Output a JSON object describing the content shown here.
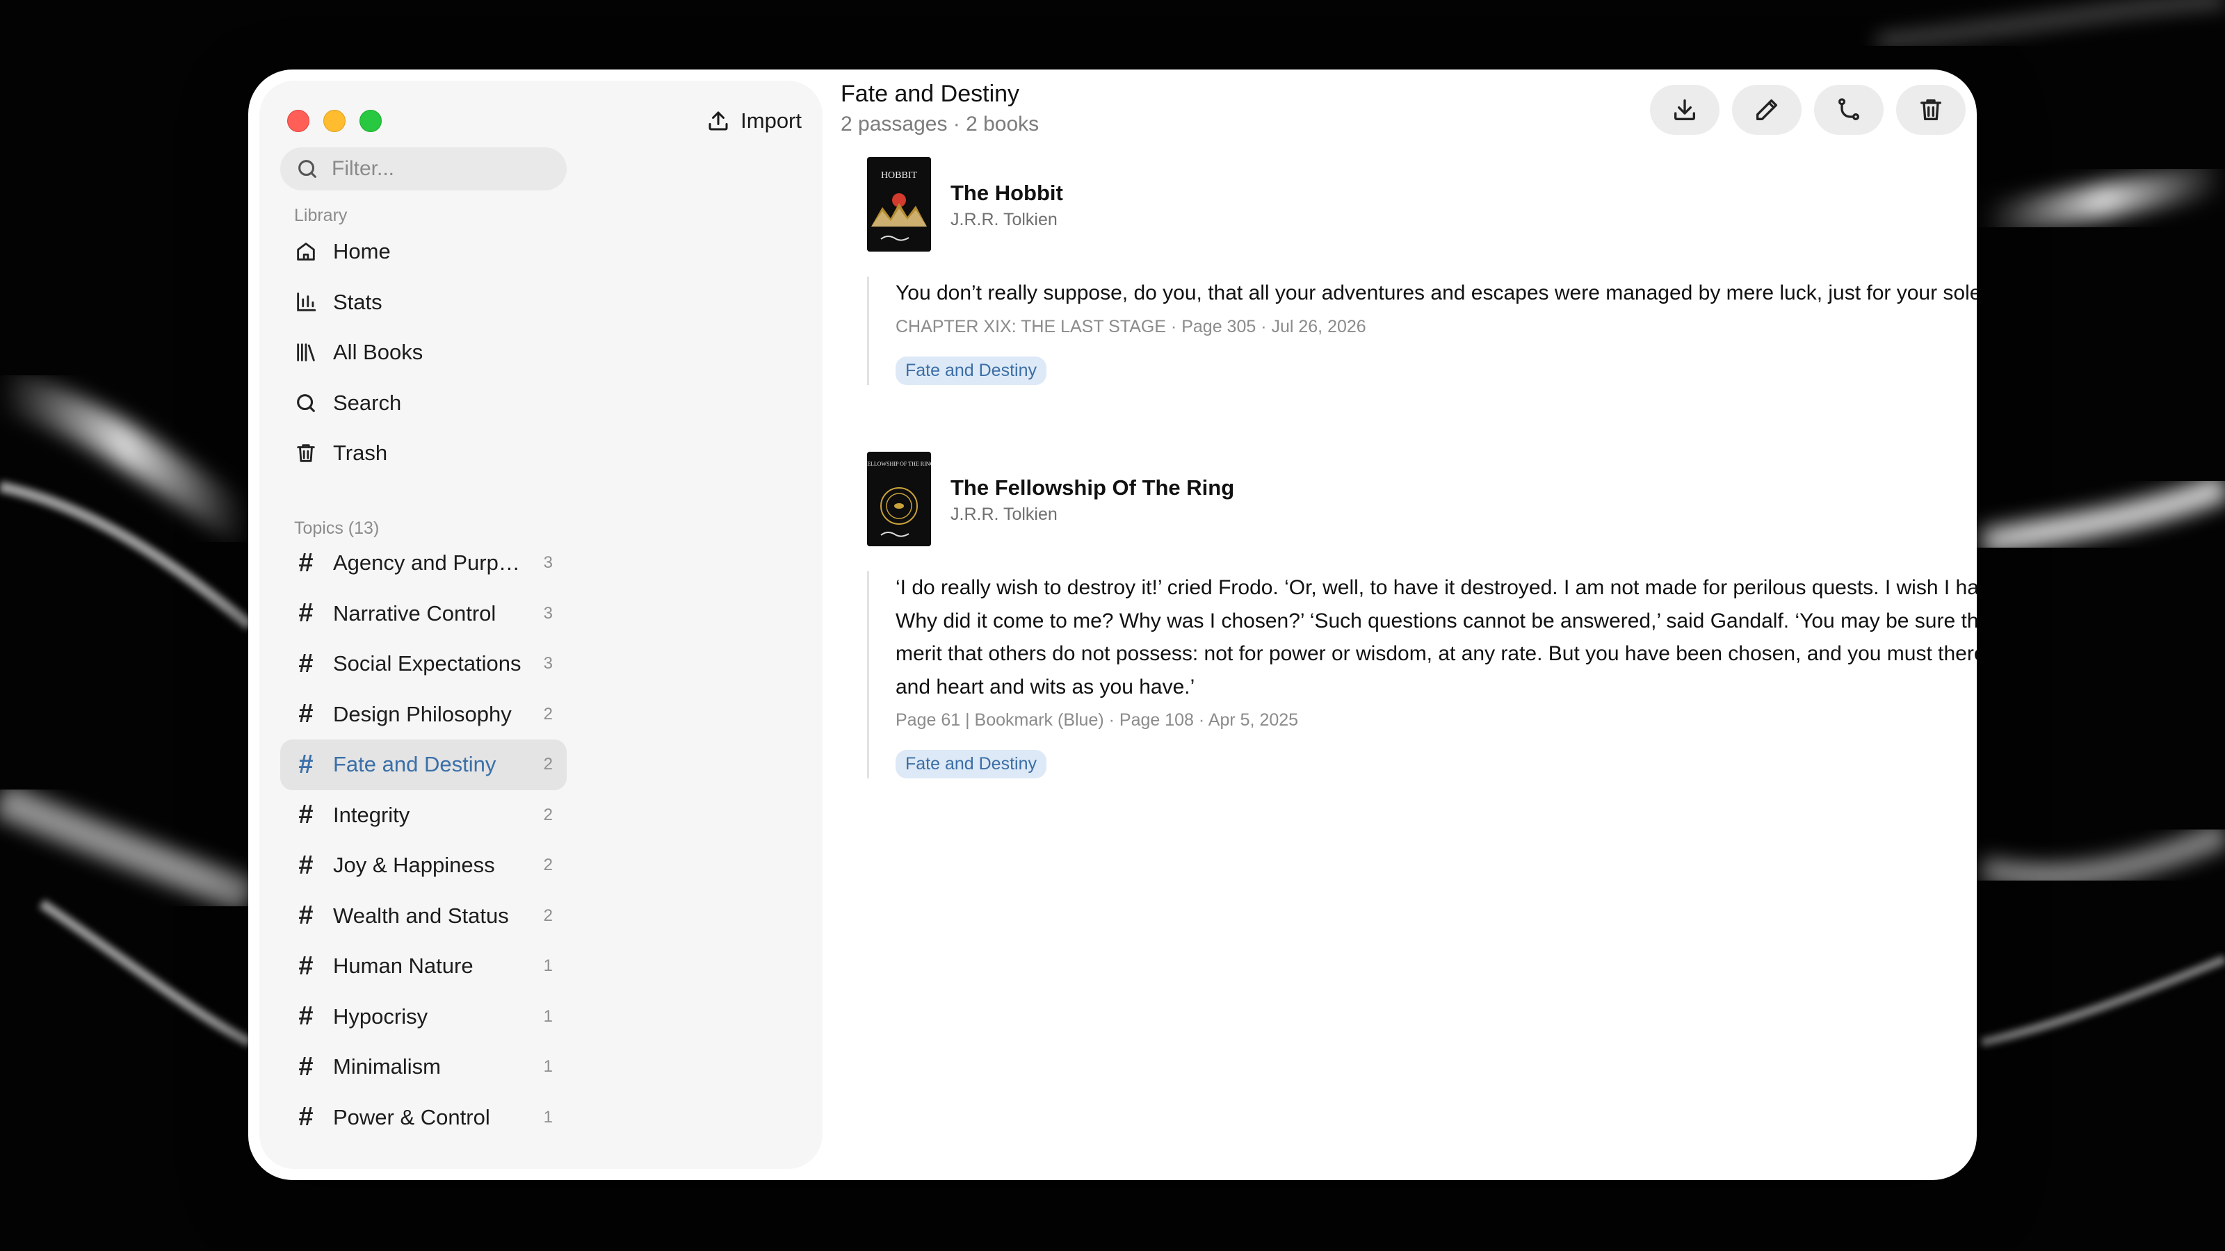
{
  "window": {
    "title": "Fate and Destiny",
    "subtitle": "2 passages · 2 books"
  },
  "sidebar": {
    "import_label": "Import",
    "filter_placeholder": "Filter...",
    "library_label": "Library",
    "library_items": [
      {
        "label": "Home",
        "icon": "home-icon"
      },
      {
        "label": "Stats",
        "icon": "stats-icon"
      },
      {
        "label": "All Books",
        "icon": "books-icon"
      },
      {
        "label": "Search",
        "icon": "search-icon"
      },
      {
        "label": "Trash",
        "icon": "trash-icon"
      }
    ],
    "topics_label": "Topics (13)",
    "topics": [
      {
        "label": "Agency and Purpo...",
        "count": "3"
      },
      {
        "label": "Narrative Control",
        "count": "3"
      },
      {
        "label": "Social Expectations",
        "count": "3"
      },
      {
        "label": "Design Philosophy",
        "count": "2"
      },
      {
        "label": "Fate and Destiny",
        "count": "2",
        "active": true
      },
      {
        "label": "Integrity",
        "count": "2"
      },
      {
        "label": "Joy & Happiness",
        "count": "2"
      },
      {
        "label": "Wealth and Status",
        "count": "2"
      },
      {
        "label": "Human Nature",
        "count": "1"
      },
      {
        "label": "Hypocrisy",
        "count": "1"
      },
      {
        "label": "Minimalism",
        "count": "1"
      },
      {
        "label": "Power & Control",
        "count": "1"
      }
    ]
  },
  "toolbar": {
    "icons": [
      "download-icon",
      "edit-icon",
      "merge-icon",
      "trash-icon"
    ]
  },
  "books": [
    {
      "title": "The Hobbit",
      "author": "J.R.R. Tolkien",
      "cover_text": "HOBBIT",
      "passage": "You don’t really suppose, do you, that all your adventures and escapes were managed by mere luck, just for your sole benefit?",
      "meta": "CHAPTER XIX: THE LAST STAGE · Page 305 · Jul 26, 2026",
      "tag": "Fate and Destiny"
    },
    {
      "title": "The Fellowship Of The Ring",
      "author": "J.R.R. Tolkien",
      "cover_text": "FELLOWSHIP OF THE RING",
      "passage": "‘I do really wish to destroy it!’ cried Frodo. ‘Or, well, to have it destroyed. I am not made for perilous quests. I wish I had never seen the Ring! Why did it come to me? Why was I chosen?’ ‘Such questions cannot be answered,’ said Gandalf. ‘You may be sure that it was not for any merit that others do not possess: not for power or wisdom, at any rate. But you have been chosen, and you must therefore use such strength and heart and wits as you have.’",
      "meta": "Page 61 | Bookmark (Blue) · Page 108 · Apr 5, 2025",
      "tag": "Fate and Destiny"
    }
  ],
  "colors": {
    "accent": "#3a6fa8",
    "tag_bg": "#dde9f6",
    "sidebar_bg": "#f6f6f6"
  }
}
